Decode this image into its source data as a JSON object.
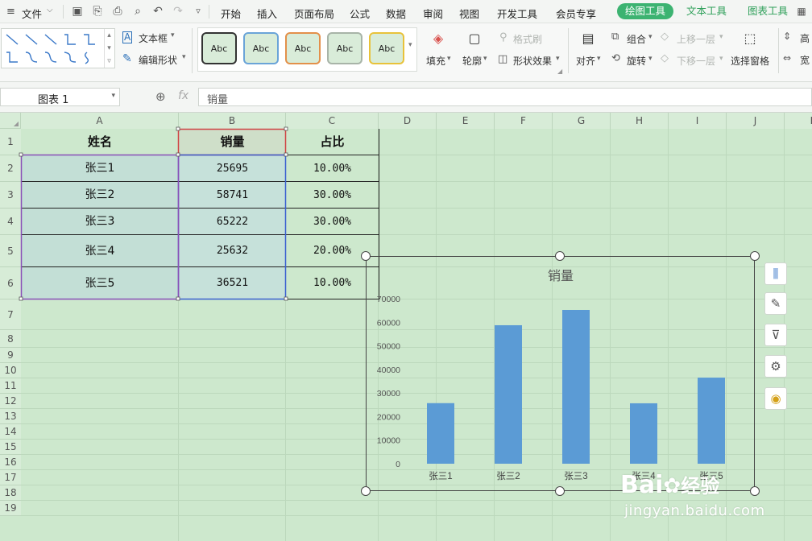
{
  "menubar": {
    "file_label": "文件",
    "menus": [
      "开始",
      "插入",
      "页面布局",
      "公式",
      "数据",
      "审阅",
      "视图",
      "开发工具",
      "会员专享"
    ],
    "context_tabs": [
      "绘图工具",
      "文本工具",
      "图表工具"
    ]
  },
  "ribbon": {
    "textbox_label": "文本框",
    "edit_shape_label": "编辑形状",
    "style_preset_label": "Abc",
    "fill_label": "填充",
    "outline_label": "轮廓",
    "format_painter_label": "格式刷",
    "shape_effects_label": "形状效果",
    "align_label": "对齐",
    "group_label": "组合",
    "rotate_label": "旋转",
    "bring_forward_label": "上移一层",
    "send_backward_label": "下移一层",
    "selection_pane_label": "选择窗格",
    "height_label": "高",
    "width_label": "宽"
  },
  "formula": {
    "name_box": "图表 1",
    "fx_label": "fx",
    "content": "销量"
  },
  "sheet": {
    "columns": [
      "A",
      "B",
      "C",
      "D",
      "E",
      "F",
      "G",
      "H",
      "I",
      "J",
      "K"
    ],
    "rows": [
      "1",
      "2",
      "3",
      "4",
      "5",
      "6",
      "7",
      "8",
      "9",
      "10",
      "11",
      "12",
      "13",
      "14",
      "15",
      "16",
      "17",
      "18",
      "19"
    ],
    "headers": [
      "姓名",
      "销量",
      "占比"
    ],
    "data": [
      [
        "张三1",
        "25695",
        "10.00%"
      ],
      [
        "张三2",
        "58741",
        "30.00%"
      ],
      [
        "张三3",
        "65222",
        "30.00%"
      ],
      [
        "张三4",
        "25632",
        "20.00%"
      ],
      [
        "张三5",
        "36521",
        "10.00%"
      ]
    ]
  },
  "chart_data": {
    "type": "bar",
    "title": "销量",
    "categories": [
      "张三1",
      "张三2",
      "张三3",
      "张三4",
      "张三5"
    ],
    "values": [
      25695,
      58741,
      65222,
      25632,
      36521
    ],
    "yticks": [
      "0",
      "10000",
      "20000",
      "30000",
      "40000",
      "50000",
      "60000",
      "70000"
    ],
    "ylim": [
      0,
      70000
    ],
    "xlabel": "",
    "ylabel": "",
    "grid": false,
    "bar_color": "#5b9bd5"
  },
  "watermark": {
    "brand": "Bai",
    "brand_suffix": "经验",
    "url": "jingyan.baidu.com"
  },
  "colors": {
    "accent": "#3cb371",
    "sheet_bg": "#cde8cd",
    "bar": "#5b9bd5"
  }
}
